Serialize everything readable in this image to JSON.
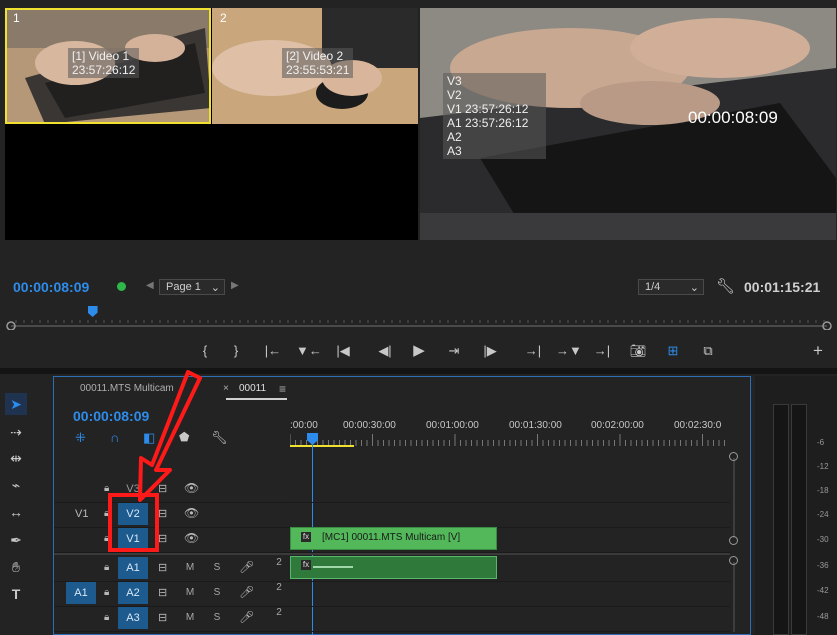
{
  "source_monitor": {
    "cam1": {
      "number": "1",
      "name": "[1] Video 1",
      "timecode": "23:57:26:12"
    },
    "cam2": {
      "number": "2",
      "name": "[2] Video 2",
      "timecode": "23:55:53:21"
    }
  },
  "program_monitor": {
    "overlay_lines": [
      "V3",
      "V2",
      "V1 23:57:26:12",
      "A1 23:57:26:12",
      "A2",
      "A3"
    ],
    "timecode": "00:00:08:09"
  },
  "source_controls": {
    "timecode": "00:00:08:09",
    "page_select": "Page 1",
    "playhead_fraction": 0.1
  },
  "program_controls": {
    "zoom_select": "1/4",
    "duration": "00:01:15:21"
  },
  "timeline": {
    "tabs": [
      "00011.MTS Multicam",
      "00011"
    ],
    "close_glyph": "×",
    "menu_glyph": "≡",
    "timecode": "00:00:08:09",
    "ruler_labels": [
      ":00:00",
      "00:00:30:00",
      "00:01:00:00",
      "00:01:30:00",
      "00:02:00:00",
      "00:02:30:0"
    ],
    "video_tracks": [
      {
        "label": "V3",
        "source": "",
        "active": false
      },
      {
        "label": "V2",
        "source": "V1",
        "active": true
      },
      {
        "label": "V1",
        "source": "",
        "active": true
      }
    ],
    "audio_tracks": [
      {
        "label": "A1",
        "source": "A1",
        "active": true,
        "mute": "M",
        "solo": "S",
        "channels": "2"
      },
      {
        "label": "A2",
        "source": "",
        "active": true,
        "mute": "M",
        "solo": "S",
        "channels": "2"
      },
      {
        "label": "A3",
        "source": "",
        "active": true,
        "mute": "M",
        "solo": "S",
        "channels": "2"
      }
    ],
    "clip_video_label": "[MC1] 00011.MTS Multicam [V]",
    "clip_fx": "fx"
  },
  "audio_meter": {
    "labels": [
      "-6",
      "-12",
      "-18",
      "-24",
      "-30",
      "-36",
      "-42",
      "-48"
    ]
  },
  "colors": {
    "accent_blue": "#2d8ceb",
    "clip_green": "#52b85a",
    "highlight_red": "#ff1a1a",
    "selection_yellow": "#f0e030"
  }
}
